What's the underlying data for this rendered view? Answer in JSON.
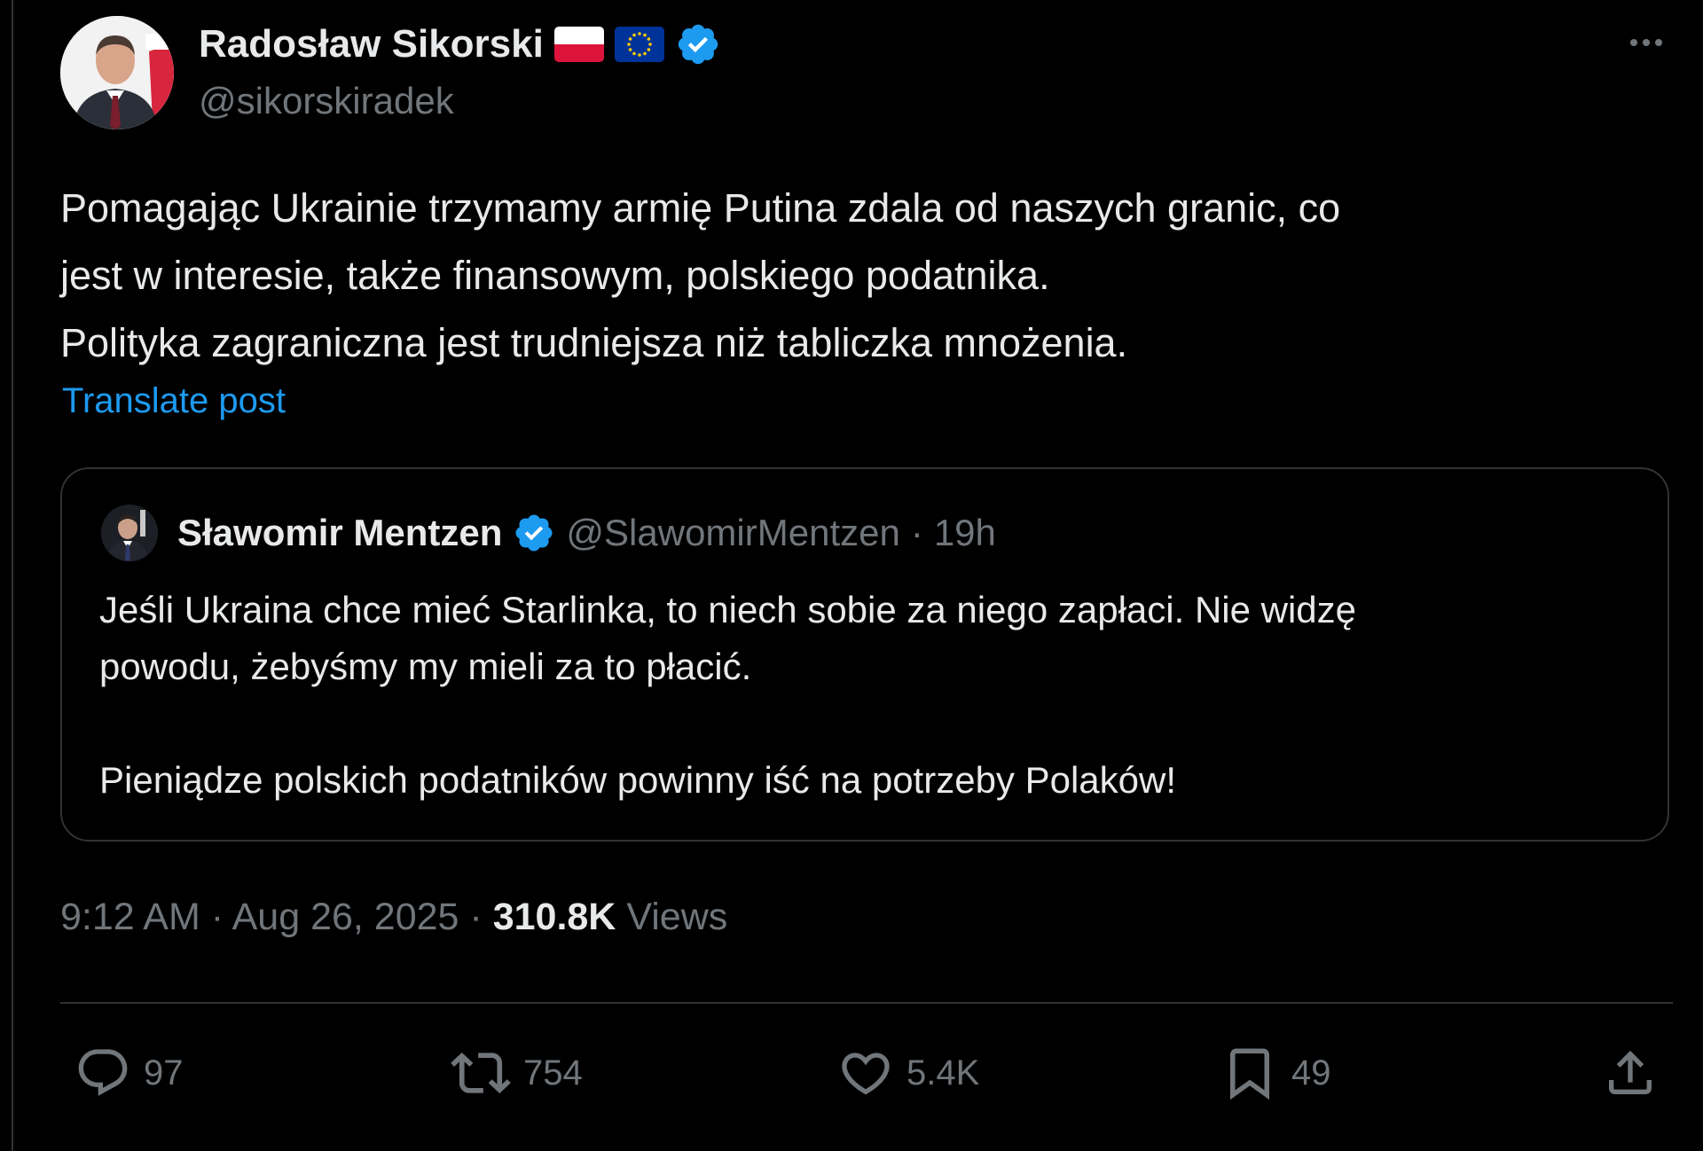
{
  "author": {
    "display_name": "Radosław Sikorski",
    "handle": "@sikorskiradek",
    "flags": [
      "poland-flag",
      "eu-flag"
    ],
    "verified_icon": "verified-badge-icon",
    "verified_color": "#1d9bf0"
  },
  "post": {
    "lines": [
      "Pomagając Ukrainie trzymamy armię Putina zdala od naszych granic, co",
      "jest w interesie, także finansowym, polskiego podatnika.",
      "Polityka zagraniczna jest trudniejsza niż tabliczka mnożenia."
    ],
    "translate_label": "Translate post"
  },
  "quoted_post": {
    "display_name": "Sławomir Mentzen",
    "handle": "@SlawomirMentzen",
    "separator": "·",
    "time": "19h",
    "lines": [
      "Jeśli Ukraina chce mieć Starlinka, to niech sobie za niego zapłaci. Nie widzę",
      "powodu, żebyśmy my mieli za to płacić.",
      "Pieniądze polskich podatników powinny iść na potrzeby Polaków!"
    ]
  },
  "meta": {
    "time": "9:12 AM",
    "separator": "·",
    "date": "Aug 26, 2025",
    "views_count": "310.8K",
    "views_label": "Views"
  },
  "actions": {
    "replies": "97",
    "reposts": "754",
    "likes": "5.4K",
    "bookmarks": "49"
  },
  "colors": {
    "background": "#000000",
    "text_primary": "#e7e9ea",
    "text_secondary": "#71767b",
    "link": "#1d9bf0",
    "border": "#2f3336"
  }
}
